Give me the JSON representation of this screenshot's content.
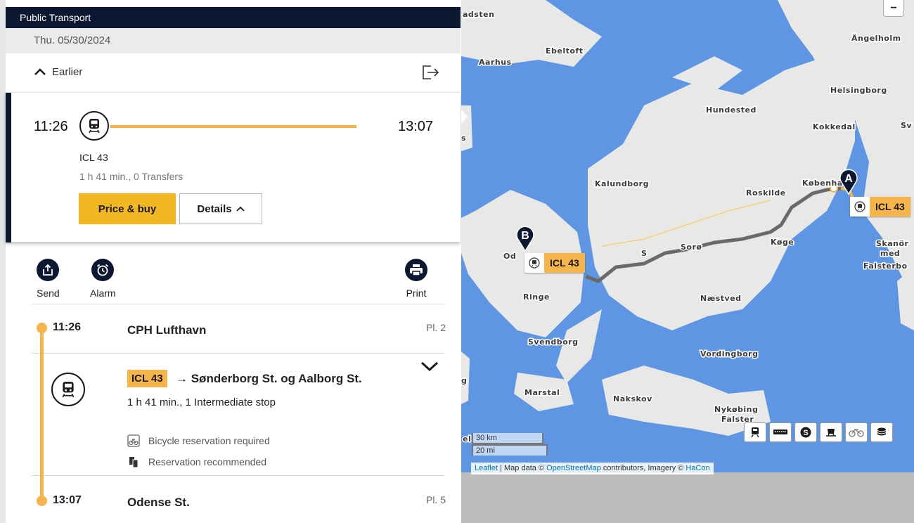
{
  "header": {
    "title": "Public Transport"
  },
  "date": "Thu. 05/30/2024",
  "earlier_label": "Earlier",
  "journey": {
    "departure": "11:26",
    "arrival": "13:07",
    "line": "ICL 43",
    "summary": "1 h 41 min., 0 Transfers",
    "price_button": "Price & buy",
    "details_button": "Details"
  },
  "actions": {
    "send": "Send",
    "alarm": "Alarm",
    "print": "Print"
  },
  "itinerary": {
    "origin": {
      "time": "11:26",
      "station": "CPH Lufthavn",
      "platform": "Pl. 2"
    },
    "segment": {
      "line": "ICL 43",
      "direction": "→ Sønderborg St. og Aalborg St.",
      "summary": "1 h 41 min., 1 Intermediate stop",
      "notes": [
        "Bicycle reservation required",
        "Reservation recommended"
      ]
    },
    "destination": {
      "time": "13:07",
      "station": "Odense St.",
      "platform": "Pl. 5"
    }
  },
  "map": {
    "places": {
      "aadsten": "adsten",
      "ebeltoft": "Ebeltoft",
      "aarhus": "Aarhus",
      "angelholm": "Ängelholm",
      "helsingborg": "Helsingborg",
      "hundested": "Hundested",
      "kokkedal": "Kokkedal",
      "sv": "Sv",
      "kalundborg": "Kalundborg",
      "roskilde": "Roskilde",
      "kobenhavn": "København",
      "koge": "Køge",
      "skanor1": "Skanör",
      "skanor2": "med",
      "skanor3": "Falsterbo",
      "od": "Od",
      "s": "S",
      "soro": "Sorø",
      "ringe": "Ringe",
      "naestved": "Næstved",
      "svendborg": "Svendborg",
      "vordingborg": "Vordingborg",
      "marstal": "Marstal",
      "nakskov": "Nakskov",
      "nykobing1": "Nykøbing",
      "nykobing2": "Falster",
      "s_edge": "s",
      "g_edge": "g",
      "el_edge": "el"
    },
    "train_label": "ICL 43",
    "pin_a": "A",
    "pin_b": "B",
    "scale": {
      "km": "30 km",
      "mi": "20 mi"
    },
    "zoom_label": "−",
    "attribution": {
      "leaflet": "Leaflet",
      "text1": " | Map data © ",
      "osm": "OpenStreetMap",
      "text2": " contributors, Imagery © ",
      "hacon": "HaCon"
    },
    "modes": [
      "train-icon",
      "regional-train-icon",
      "s-train-icon",
      "metro-icon",
      "bicycle-icon",
      "layers-icon"
    ]
  },
  "colors": {
    "navy": "#0c1832",
    "accent": "#f6b54a",
    "button_yellow": "#f2b822",
    "sea": "#5f96e4",
    "land": "#e8e8e6"
  }
}
